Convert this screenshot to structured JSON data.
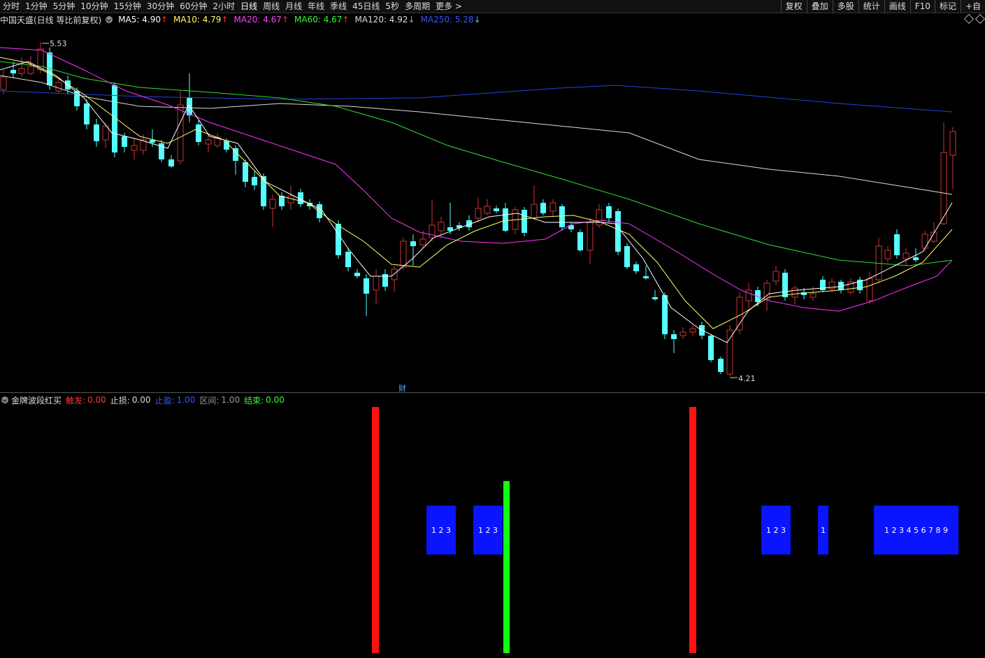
{
  "toolbar": {
    "periods": [
      "分时",
      "1分钟",
      "5分钟",
      "10分钟",
      "15分钟",
      "30分钟",
      "60分钟",
      "2小时",
      "日线",
      "周线",
      "月线",
      "年线",
      "季线",
      "45日线",
      "5秒",
      "多周期",
      "更多 >"
    ],
    "active_period": "日线",
    "right_items": [
      "复权",
      "叠加",
      "多股",
      "统计",
      "画线",
      "F10",
      "标记",
      "+自"
    ]
  },
  "ma_bar": {
    "stock": "中国天盛(日线 等比前复权)",
    "ma5": "MA5: 4.90",
    "ma10": "MA10: 4.79",
    "ma20": "MA20: 4.67",
    "ma60": "MA60: 4.67",
    "ma120": "MA120: 4.92",
    "ma250": "MA250: 5.28",
    "arrow_up": "↑",
    "arrow_down": "↓",
    "colors": {
      "ma5": "#ffffff",
      "ma10": "#ffff66",
      "ma20": "#ff44ff",
      "ma60": "#33ff33",
      "ma120": "#dddddd",
      "ma250": "#3355ff",
      "up": "#ff3333",
      "down": "#55bbff"
    }
  },
  "price_labels": {
    "high": "5.53",
    "low": "4.21",
    "cai": "财"
  },
  "indicator": {
    "name": "金牌波段红买",
    "trigger_label": "触发:",
    "trigger_val": "0.00",
    "stoploss_label": "止损:",
    "stoploss_val": "0.00",
    "takeprofit_label": "止盈:",
    "takeprofit_val": "1.00",
    "range_label": "区间:",
    "range_val": "1.00",
    "end_label": "结束:",
    "end_val": "0.00",
    "colors": {
      "trigger": "#ff3333",
      "takeprofit": "#3355ff",
      "range": "#999999",
      "end": "#33ff33"
    }
  },
  "signal_boxes": [
    {
      "text": "1 2 3"
    },
    {
      "text": "1 2 3"
    },
    {
      "text": "1 2 3"
    },
    {
      "text": "1"
    },
    {
      "text": "1 2 3 4 5 6 7 8 9"
    }
  ]
}
